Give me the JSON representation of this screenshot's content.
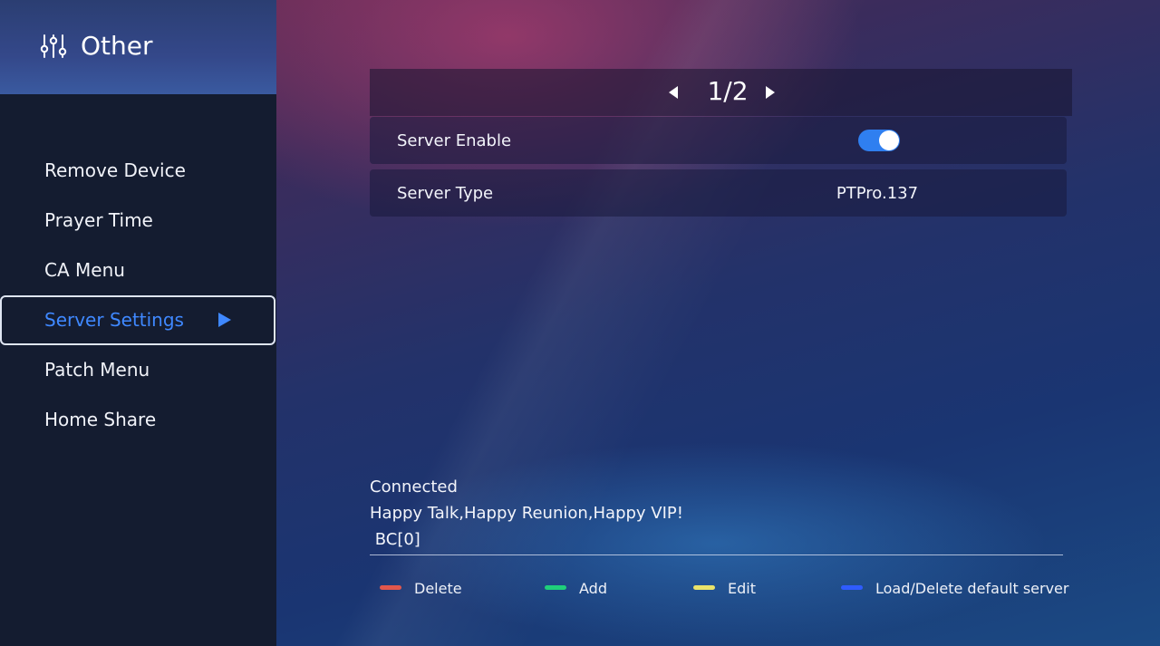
{
  "sidebar": {
    "title": "Other",
    "title_icon": "sliders-icon",
    "items": [
      {
        "label": "Remove Device"
      },
      {
        "label": "Prayer Time"
      },
      {
        "label": "CA Menu"
      },
      {
        "label": "Server Settings",
        "selected": true
      },
      {
        "label": "Patch Menu"
      },
      {
        "label": "Home Share"
      }
    ]
  },
  "pager": {
    "page": "1/2",
    "prev_icon": "triangle-left-icon",
    "next_icon": "triangle-right-icon"
  },
  "settings": [
    {
      "label": "Server Enable",
      "type": "toggle",
      "on": true
    },
    {
      "label": "Server Type",
      "value": "PTPro.137"
    }
  ],
  "status": {
    "connection": "Connected",
    "message": "Happy Talk,Happy Reunion,Happy VIP!",
    "code": " BC[0]"
  },
  "legend": [
    {
      "label": "Delete",
      "color": "#e2574c"
    },
    {
      "label": "Add",
      "color": "#1fcf7a"
    },
    {
      "label": "Edit",
      "color": "#eae36a"
    },
    {
      "label": "Load/Delete default server",
      "color": "#2f5cff"
    }
  ],
  "colors": {
    "accent": "#3f88ff",
    "toggle_on": "#2f7ff0"
  }
}
